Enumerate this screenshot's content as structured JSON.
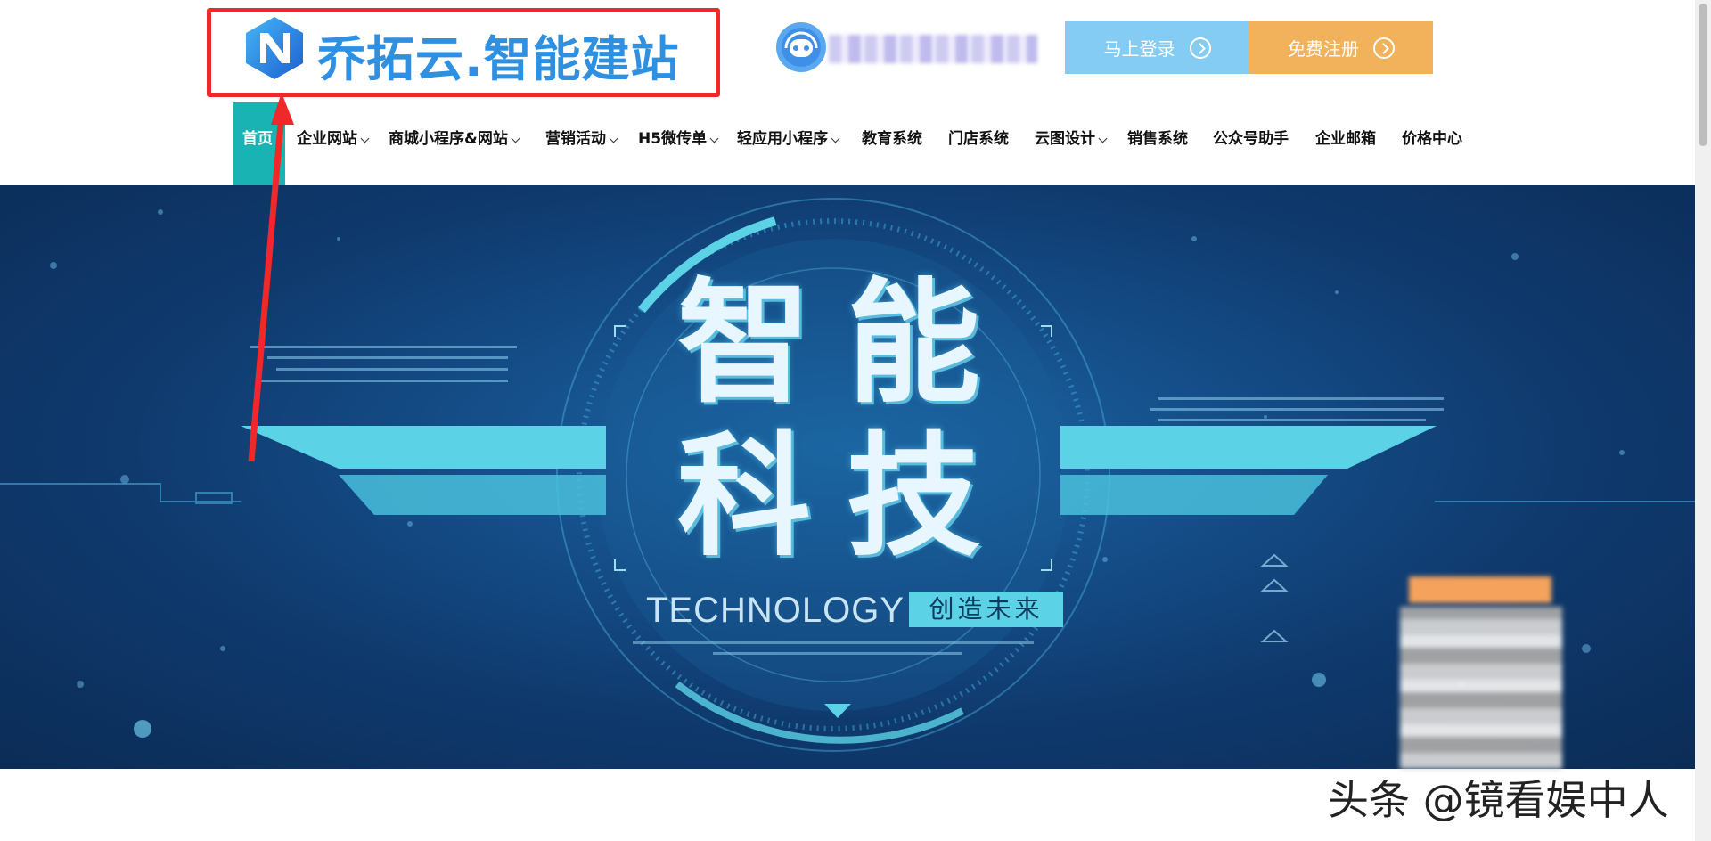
{
  "header": {
    "logo_text": "乔拓云.智能建站",
    "login_label": "马上登录",
    "register_label": "免费注册"
  },
  "nav": {
    "items": [
      {
        "label": "首页",
        "active": true
      },
      {
        "label": "企业网站",
        "dropdown": true
      },
      {
        "label": "商城小程序&网站",
        "dropdown": true
      },
      {
        "label": "营销活动",
        "dropdown": true
      },
      {
        "label": "H5微传单",
        "dropdown": true
      },
      {
        "label": "轻应用小程序",
        "dropdown": true
      },
      {
        "label": "教育系统"
      },
      {
        "label": "门店系统"
      },
      {
        "label": "云图设计",
        "dropdown": true
      },
      {
        "label": "销售系统"
      },
      {
        "label": "公众号助手"
      },
      {
        "label": "企业邮箱"
      },
      {
        "label": "价格中心"
      }
    ]
  },
  "banner": {
    "title_line1": "智能",
    "title_line2": "科技",
    "tech_text": "TECHNOLOGY",
    "slogan": "创造未来"
  },
  "watermark": "头条 @镜看娱中人",
  "colors": {
    "brand_blue": "#2f8fe0",
    "login_btn": "#85ccf5",
    "register_btn": "#f2b25c",
    "nav_active": "#1ab3b3",
    "annotation_red": "#f0282a"
  }
}
